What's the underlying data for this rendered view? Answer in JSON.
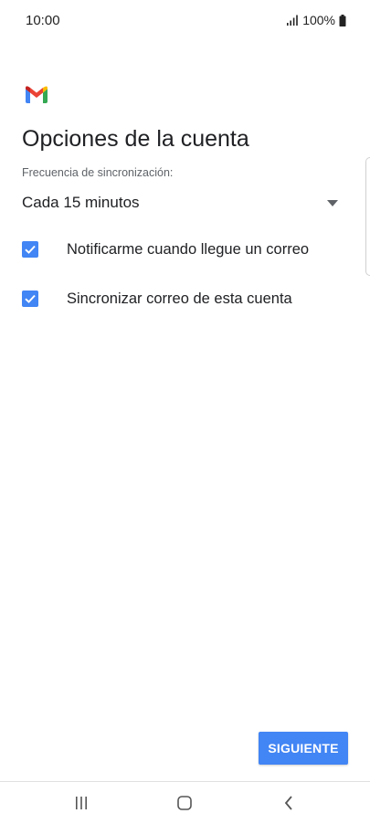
{
  "status_bar": {
    "time": "10:00",
    "battery": "100%",
    "icons": [
      "signal-icon",
      "battery-icon"
    ]
  },
  "app": {
    "logo": "gmail-logo",
    "title": "Opciones de la cuenta"
  },
  "sync_frequency": {
    "label": "Frecuencia de sincronización:",
    "selected": "Cada 15 minutos",
    "icon": "dropdown-arrow-icon"
  },
  "options": [
    {
      "label": "Notificarme cuando llegue un correo",
      "checked": true
    },
    {
      "label": "Sincronizar correo de esta cuenta",
      "checked": true
    }
  ],
  "next_button": {
    "label": "SIGUIENTE"
  },
  "nav_bar": {
    "icons": [
      "recents-icon",
      "home-icon",
      "back-icon"
    ]
  },
  "colors": {
    "accent": "#4285f4",
    "text": "#202124",
    "secondary_text": "#5f6368"
  }
}
